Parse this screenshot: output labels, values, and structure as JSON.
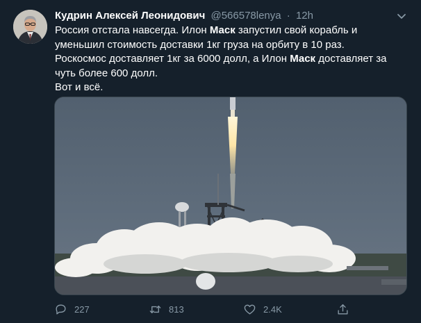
{
  "tweet": {
    "author_name": "Кудрин Алексей Леонидович",
    "handle": "@566578lenya",
    "separator": "·",
    "time": "12h",
    "text_lines": [
      [
        "Россия отстала навсегда. Илон ",
        "Маск",
        " запустил свой корабль и"
      ],
      [
        "уменьшил стоимость доставки 1кг груза на орбиту в 10 раз."
      ],
      [
        "Роскосмос доставляет 1кг за 6000 долл, а Илон ",
        "Маск",
        " доставляет за"
      ],
      [
        "чуть более 600 долл."
      ],
      [
        "Вот и всё."
      ]
    ]
  },
  "actions": {
    "reply_count": "227",
    "retweet_count": "813",
    "like_count": "2.4K"
  },
  "icons": {
    "reply": "reply-icon",
    "retweet": "retweet-icon",
    "like": "heart-icon",
    "share": "share-icon",
    "more": "chevron-down-icon"
  },
  "colors": {
    "background": "#15202b",
    "secondary_text": "#8899a6",
    "border": "#38444d"
  }
}
